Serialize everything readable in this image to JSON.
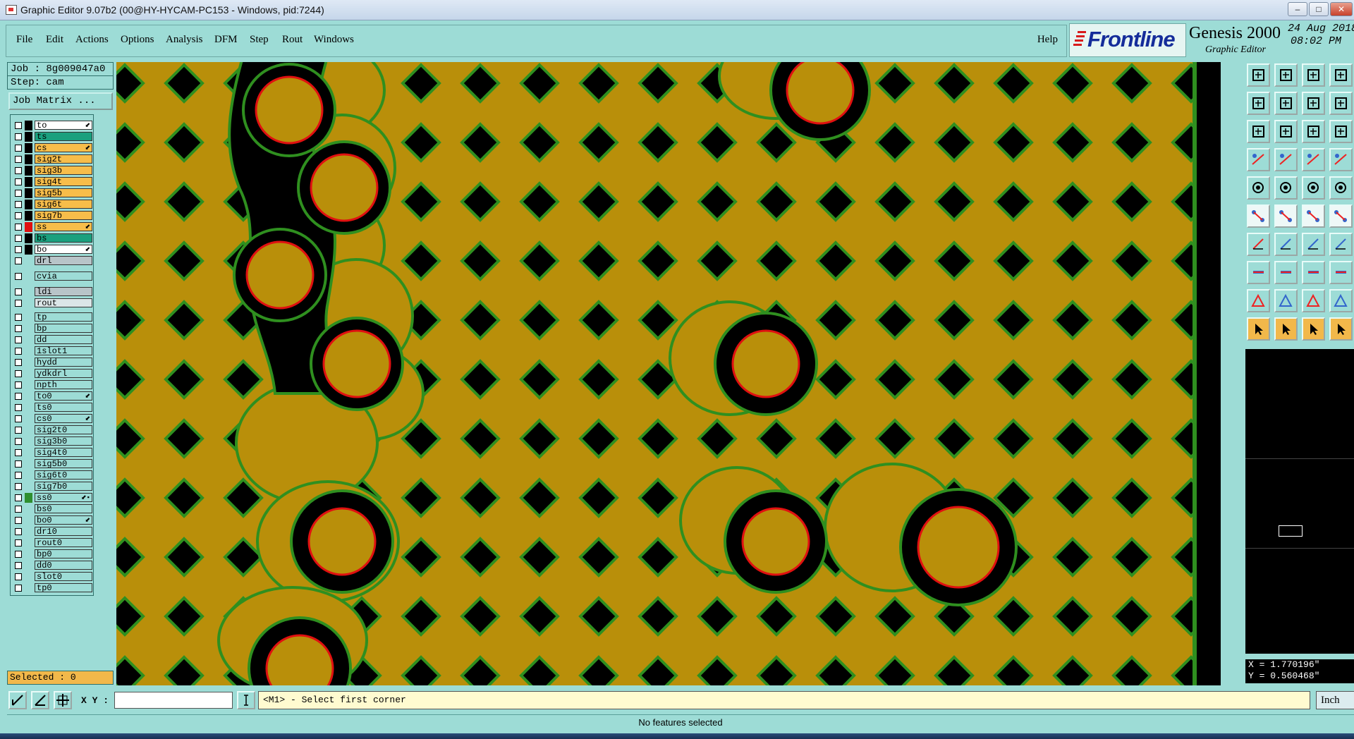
{
  "window": {
    "title": "Graphic Editor 9.07b2 (00@HY-HYCAM-PC153 - Windows, pid:7244)",
    "controls": [
      "–",
      "□",
      "✕"
    ]
  },
  "menu": [
    "File",
    "Edit",
    "Actions",
    "Options",
    "Analysis",
    "DFM",
    "Step",
    "Rout",
    "Windows"
  ],
  "help": "Help",
  "branding": {
    "logo": "Frontline",
    "product": "Genesis 2000",
    "subtitle": "Graphic Editor",
    "date": "24 Aug 2018",
    "time": "08:02 PM"
  },
  "job": "Job : 8g009047a0",
  "step": "Step: cam",
  "job_matrix": "Job Matrix ...",
  "layers": [
    {
      "name": "to",
      "color": "#ffffff",
      "mark": "#000000",
      "flag": "⬋"
    },
    {
      "name": "ts",
      "color": "#1aa07e",
      "mark": "#000000",
      "flag": ""
    },
    {
      "name": "cs",
      "color": "#f7bd4a",
      "mark": "#000000",
      "flag": "⬋"
    },
    {
      "name": "sig2t",
      "color": "#f7bd4a",
      "mark": "#000000",
      "flag": ""
    },
    {
      "name": "sig3b",
      "color": "#f7bd4a",
      "mark": "#000000",
      "flag": ""
    },
    {
      "name": "sig4t",
      "color": "#f7bd4a",
      "mark": "#000000",
      "flag": ""
    },
    {
      "name": "sig5b",
      "color": "#f7bd4a",
      "mark": "#000000",
      "flag": ""
    },
    {
      "name": "sig6t",
      "color": "#f7bd4a",
      "mark": "#000000",
      "flag": ""
    },
    {
      "name": "sig7b",
      "color": "#f7bd4a",
      "mark": "#000000",
      "flag": ""
    },
    {
      "name": "ss",
      "color": "#f7bd4a",
      "mark": "#e01010",
      "flag": "⬋"
    },
    {
      "name": "bs",
      "color": "#1aa07e",
      "mark": "#000000",
      "flag": ""
    },
    {
      "name": "bo",
      "color": "#ffffff",
      "mark": "#000000",
      "flag": "⬋"
    },
    {
      "name": "drl",
      "color": "#b8c4c8",
      "mark": "#9ddcd6",
      "flag": ""
    },
    {
      "name": "cvia",
      "color": "#9ddcd6",
      "mark": "#9ddcd6",
      "flag": ""
    },
    {
      "name": "ldi",
      "color": "#b8c4c8",
      "mark": "#9ddcd6",
      "flag": ""
    },
    {
      "name": "rout",
      "color": "#dbe6e8",
      "mark": "#9ddcd6",
      "flag": ""
    },
    {
      "name": "tp",
      "color": "#9ddcd6",
      "mark": "#9ddcd6",
      "flag": ""
    },
    {
      "name": "bp",
      "color": "#9ddcd6",
      "mark": "#9ddcd6",
      "flag": ""
    },
    {
      "name": "dd",
      "color": "#9ddcd6",
      "mark": "#9ddcd6",
      "flag": ""
    },
    {
      "name": "1slot1",
      "color": "#9ddcd6",
      "mark": "#9ddcd6",
      "flag": ""
    },
    {
      "name": "hydd",
      "color": "#9ddcd6",
      "mark": "#9ddcd6",
      "flag": ""
    },
    {
      "name": "ydkdrl",
      "color": "#9ddcd6",
      "mark": "#9ddcd6",
      "flag": ""
    },
    {
      "name": "npth",
      "color": "#9ddcd6",
      "mark": "#9ddcd6",
      "flag": ""
    },
    {
      "name": "to0",
      "color": "#9ddcd6",
      "mark": "#9ddcd6",
      "flag": "⬋"
    },
    {
      "name": "ts0",
      "color": "#9ddcd6",
      "mark": "#9ddcd6",
      "flag": ""
    },
    {
      "name": "cs0",
      "color": "#9ddcd6",
      "mark": "#9ddcd6",
      "flag": "⬋"
    },
    {
      "name": "sig2t0",
      "color": "#9ddcd6",
      "mark": "#9ddcd6",
      "flag": ""
    },
    {
      "name": "sig3b0",
      "color": "#9ddcd6",
      "mark": "#9ddcd6",
      "flag": ""
    },
    {
      "name": "sig4t0",
      "color": "#9ddcd6",
      "mark": "#9ddcd6",
      "flag": ""
    },
    {
      "name": "sig5b0",
      "color": "#9ddcd6",
      "mark": "#9ddcd6",
      "flag": ""
    },
    {
      "name": "sig6t0",
      "color": "#9ddcd6",
      "mark": "#9ddcd6",
      "flag": ""
    },
    {
      "name": "sig7b0",
      "color": "#9ddcd6",
      "mark": "#9ddcd6",
      "flag": ""
    },
    {
      "name": "ss0",
      "color": "#9ddcd6",
      "mark": "#2f8f2f",
      "flag": "⬋▪"
    },
    {
      "name": "bs0",
      "color": "#9ddcd6",
      "mark": "#9ddcd6",
      "flag": ""
    },
    {
      "name": "bo0",
      "color": "#9ddcd6",
      "mark": "#9ddcd6",
      "flag": "⬋"
    },
    {
      "name": "dr10",
      "color": "#9ddcd6",
      "mark": "#9ddcd6",
      "flag": ""
    },
    {
      "name": "rout0",
      "color": "#9ddcd6",
      "mark": "#9ddcd6",
      "flag": ""
    },
    {
      "name": "bp0",
      "color": "#9ddcd6",
      "mark": "#9ddcd6",
      "flag": ""
    },
    {
      "name": "dd0",
      "color": "#9ddcd6",
      "mark": "#9ddcd6",
      "flag": ""
    },
    {
      "name": "slot0",
      "color": "#9ddcd6",
      "mark": "#9ddcd6",
      "flag": ""
    },
    {
      "name": "tp0",
      "color": "#9ddcd6",
      "mark": "#9ddcd6",
      "flag": ""
    }
  ],
  "selected": "Selected : 0",
  "coords": {
    "x": "X = 1.770196\"",
    "y": "Y = 0.560468\""
  },
  "command": {
    "xy_label": "X Y :",
    "xy_value": "",
    "prompt": "<M1> - Select first corner",
    "units": "Inch"
  },
  "status": "No features selected",
  "colors": {
    "copper": "#b98f0a",
    "void": "#000000",
    "outline": "#2f8f1f",
    "pad_ring": "#e01010",
    "ui_background": "#9ddcd6"
  },
  "toolbar_icons": [
    "zoom-home-icon",
    "zoom-fit-icon",
    "zoom-layer-icon",
    "zoom-window-icon",
    "zoom-in-icon",
    "zoom-out-icon",
    "zoom-back-icon",
    "snap-icon",
    "pan-icon",
    "center-icon",
    "one-to-one-icon",
    "help-icon",
    "measure-icon",
    "grid-icon",
    "layers-connect-icon",
    "snap-edge-icon",
    "pad-icon",
    "line-icon",
    "rule-icon",
    "circle-icon",
    "node-icon",
    "intersect-icon",
    "point-icon",
    "arc-icon",
    "angle-red-icon",
    "angle-blue-icon",
    "curve-icon",
    "net-icon",
    "align-icon",
    "stretch-icon",
    "distance-icon",
    "copy-icon",
    "triangle-red-icon",
    "triangle-blue-icon",
    "triangle-a-icon",
    "triangle-b-icon",
    "select-icon",
    "select-dark-icon",
    "select-outline-icon",
    "route-select-icon"
  ]
}
